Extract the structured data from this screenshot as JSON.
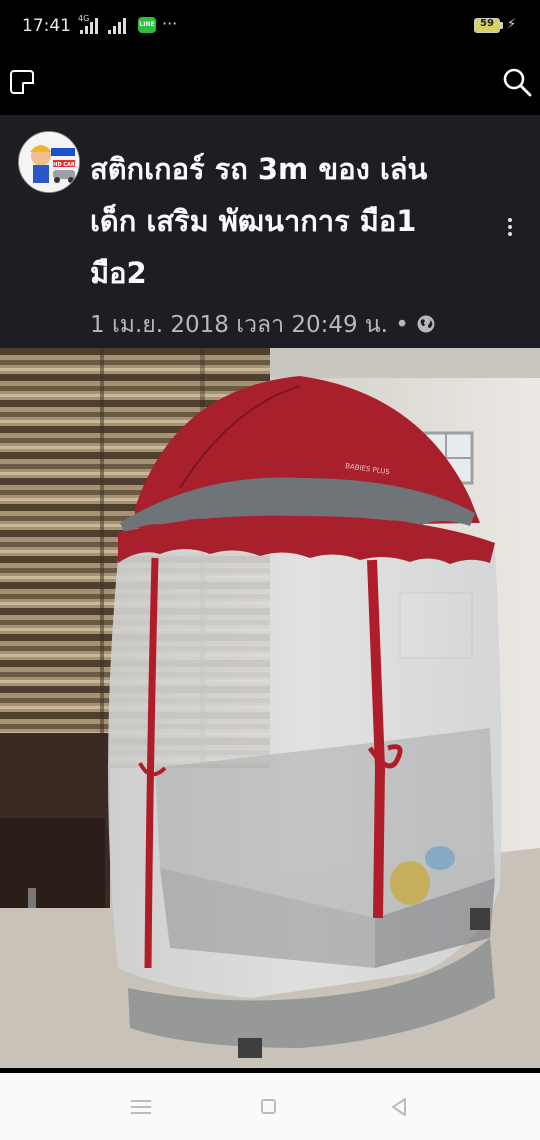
{
  "status_bar": {
    "time": "17:41",
    "network": "4G",
    "app_icon": "LINE",
    "more": "···",
    "battery_level": "59"
  },
  "post": {
    "title": "สติกเกอร์ รถ 3m ของ เล่น เด็ก เสริม พัฒนาการ มือ1 มือ2",
    "date": "1 เม.ย. 2018 เวลา 20:49 น. •",
    "avatar_text": "HD CAR"
  },
  "photo": {
    "subject": "baby-playpen-with-red-canopy-mosquito-net"
  },
  "icons": {
    "expand": "expand-icon",
    "search": "search-icon",
    "more": "kebab-menu-icon",
    "privacy": "globe-icon",
    "nav": [
      "menu-icon",
      "home-icon",
      "back-icon"
    ]
  },
  "colors": {
    "header_bg": "#1c1e24",
    "canopy_red": "#a8202c"
  }
}
